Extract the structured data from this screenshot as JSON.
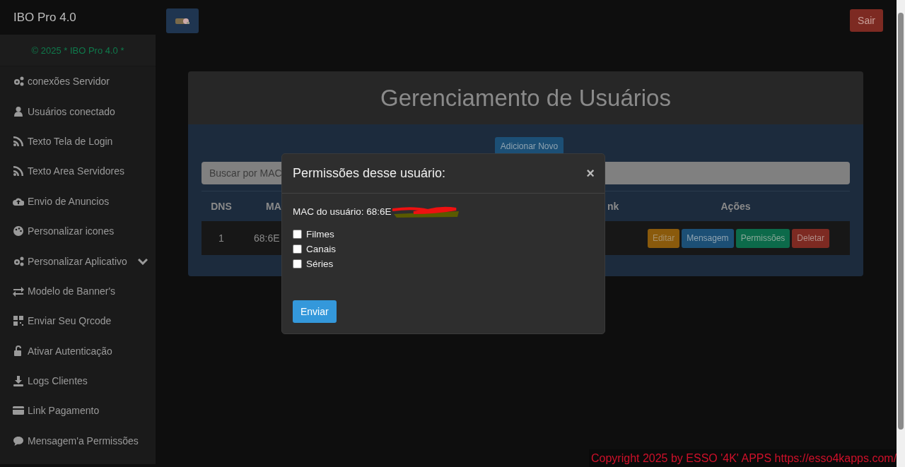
{
  "brand": "IBO Pro 4.0",
  "sidebar": {
    "copyright": "© 2025 * IBO Pro 4.0 *",
    "items": [
      {
        "label": "conexões Servidor",
        "has_submenu": false
      },
      {
        "label": "Usuários conectado",
        "has_submenu": false
      },
      {
        "label": "Texto Tela de Login",
        "has_submenu": false
      },
      {
        "label": "Texto Area Servidores",
        "has_submenu": false
      },
      {
        "label": "Envio de Anuncios",
        "has_submenu": false
      },
      {
        "label": "Personalizar icones",
        "has_submenu": false
      },
      {
        "label": "Personalizar Aplicativo",
        "has_submenu": true
      },
      {
        "label": "Modelo de Banner's",
        "has_submenu": false
      },
      {
        "label": "Enviar Seu Qrcode",
        "has_submenu": false
      },
      {
        "label": "Ativar Autenticação",
        "has_submenu": false
      },
      {
        "label": "Logs Clientes",
        "has_submenu": false
      },
      {
        "label": "Link Pagamento",
        "has_submenu": false
      },
      {
        "label": "Mensagem'a Permissões",
        "has_submenu": false
      }
    ]
  },
  "header": {
    "logout": "Sair"
  },
  "card": {
    "title": "Gerenciamento de Usuários",
    "add_button": "Adicionar Novo",
    "search": {
      "placeholder": "Buscar por MAC"
    },
    "table": {
      "columns": [
        "DNS",
        "MA",
        "nk",
        "Ações"
      ],
      "rows": [
        {
          "dns": "1",
          "mac": "68:6E",
          "actions": [
            {
              "label": "Editar",
              "kind": "edit"
            },
            {
              "label": "Mensagem",
              "kind": "message"
            },
            {
              "label": "Permissões",
              "kind": "permissions"
            },
            {
              "label": "Deletar",
              "kind": "delete"
            }
          ]
        }
      ]
    }
  },
  "modal": {
    "title": "Permissões desse usuário:",
    "close": "×",
    "mac_line": "MAC do usuário: 68:6E",
    "redacted": true,
    "options": [
      {
        "label": "Filmes",
        "checked": false
      },
      {
        "label": "Canais",
        "checked": false
      },
      {
        "label": "Séries",
        "checked": false
      }
    ],
    "submit": "Enviar"
  },
  "footer": {
    "copyright": "Copyright 2025  by ESSO '4K' APPS https://esso4kapps.com/"
  }
}
